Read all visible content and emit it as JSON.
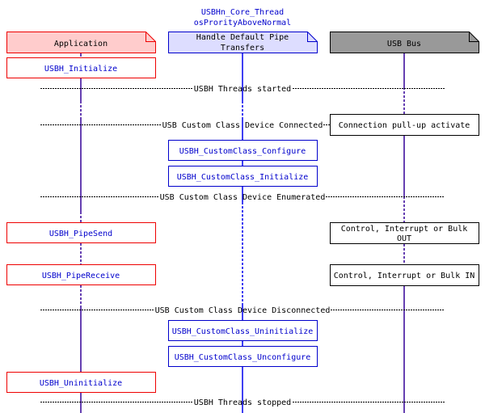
{
  "diagram": {
    "type": "sequence",
    "colors": {
      "app_fill": "#ffcccc",
      "app_stroke": "#ee0000",
      "core_fill": "#ddddff",
      "core_stroke": "#0000cc",
      "bus_fill": "#999999",
      "bus_stroke": "#000000",
      "lifeline_app": "#330099",
      "lifeline_core": "#0000ee",
      "lifeline_bus": "#330099",
      "label_blue": "#0000cc",
      "text_black": "#000000"
    },
    "thread_title": {
      "line1": "USBHn_Core_Thread",
      "line2": "osProrityAboveNormal"
    },
    "lanes": [
      {
        "id": "app",
        "label": "Application"
      },
      {
        "id": "core",
        "label_line1": "Handle Default Pipe",
        "label_line2": "Transfers"
      },
      {
        "id": "bus",
        "label": "USB Bus"
      }
    ],
    "separators": [
      {
        "label": "USBH Threads started"
      },
      {
        "label": "USB Custom Class Device Connected"
      },
      {
        "label": "USB Custom Class Device Enumerated"
      },
      {
        "label": "USB Custom Class Device Disconnected"
      },
      {
        "label": "USBH Threads stopped"
      }
    ],
    "app_calls": [
      {
        "label": "USBH_Initialize"
      },
      {
        "label": "USBH_PipeSend"
      },
      {
        "label": "USBH_PipeReceive"
      },
      {
        "label": "USBH_Uninitialize"
      }
    ],
    "core_calls": [
      {
        "label": "USBH_CustomClass_Configure"
      },
      {
        "label": "USBH_CustomClass_Initialize"
      },
      {
        "label": "USBH_CustomClass_Uninitialize"
      },
      {
        "label": "USBH_CustomClass_Unconfigure"
      }
    ],
    "bus_events": [
      {
        "label": "Connection pull-up activate"
      },
      {
        "label_line1": "Control, Interrupt or Bulk",
        "label_line2": "OUT"
      },
      {
        "label": "Control, Interrupt or Bulk IN"
      }
    ]
  }
}
